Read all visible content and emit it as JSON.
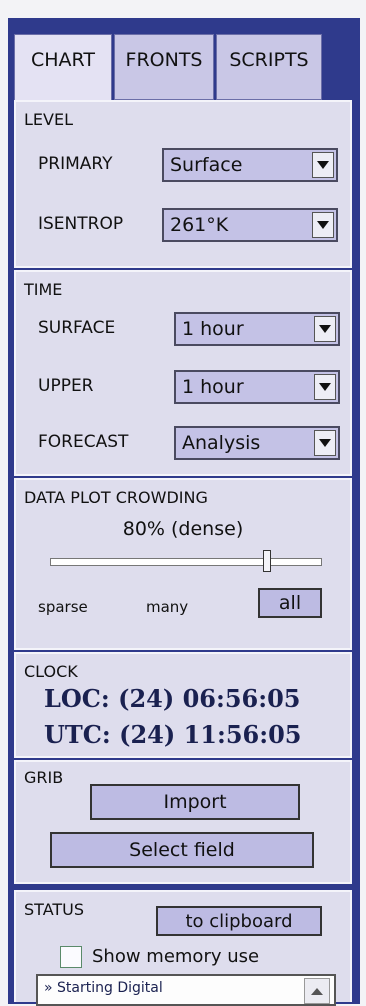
{
  "tabs": [
    {
      "label": "CHART",
      "active": true
    },
    {
      "label": "FRONTS",
      "active": false
    },
    {
      "label": "SCRIPTS",
      "active": false
    }
  ],
  "level": {
    "title": "LEVEL",
    "primary_label": "PRIMARY",
    "primary_value": "Surface",
    "isentrop_label": "ISENTROP",
    "isentrop_value": "261°K"
  },
  "time": {
    "title": "TIME",
    "surface_label": "SURFACE",
    "surface_value": "1 hour",
    "upper_label": "UPPER",
    "upper_value": "1 hour",
    "forecast_label": "FORECAST",
    "forecast_value": "Analysis"
  },
  "crowding": {
    "title": "DATA PLOT CROWDING",
    "value_text": "80% (dense)",
    "slider_fraction": 0.8,
    "sparse_label": "sparse",
    "many_label": "many",
    "all_button": "all"
  },
  "clock": {
    "title": "CLOCK",
    "loc": "LOC: (24) 06:56:05",
    "utc": "UTC: (24) 11:56:05"
  },
  "grib": {
    "title": "GRIB",
    "import_button": "Import",
    "select_button": "Select field"
  },
  "status": {
    "title": "STATUS",
    "clipboard_button": "to clipboard",
    "memory_label": "Show memory use",
    "memory_checked": false,
    "log_text": "» Starting Digital"
  },
  "colors": {
    "frame": "#2f3a8c",
    "panel": "#dedded",
    "control": "#c4c2e6"
  }
}
